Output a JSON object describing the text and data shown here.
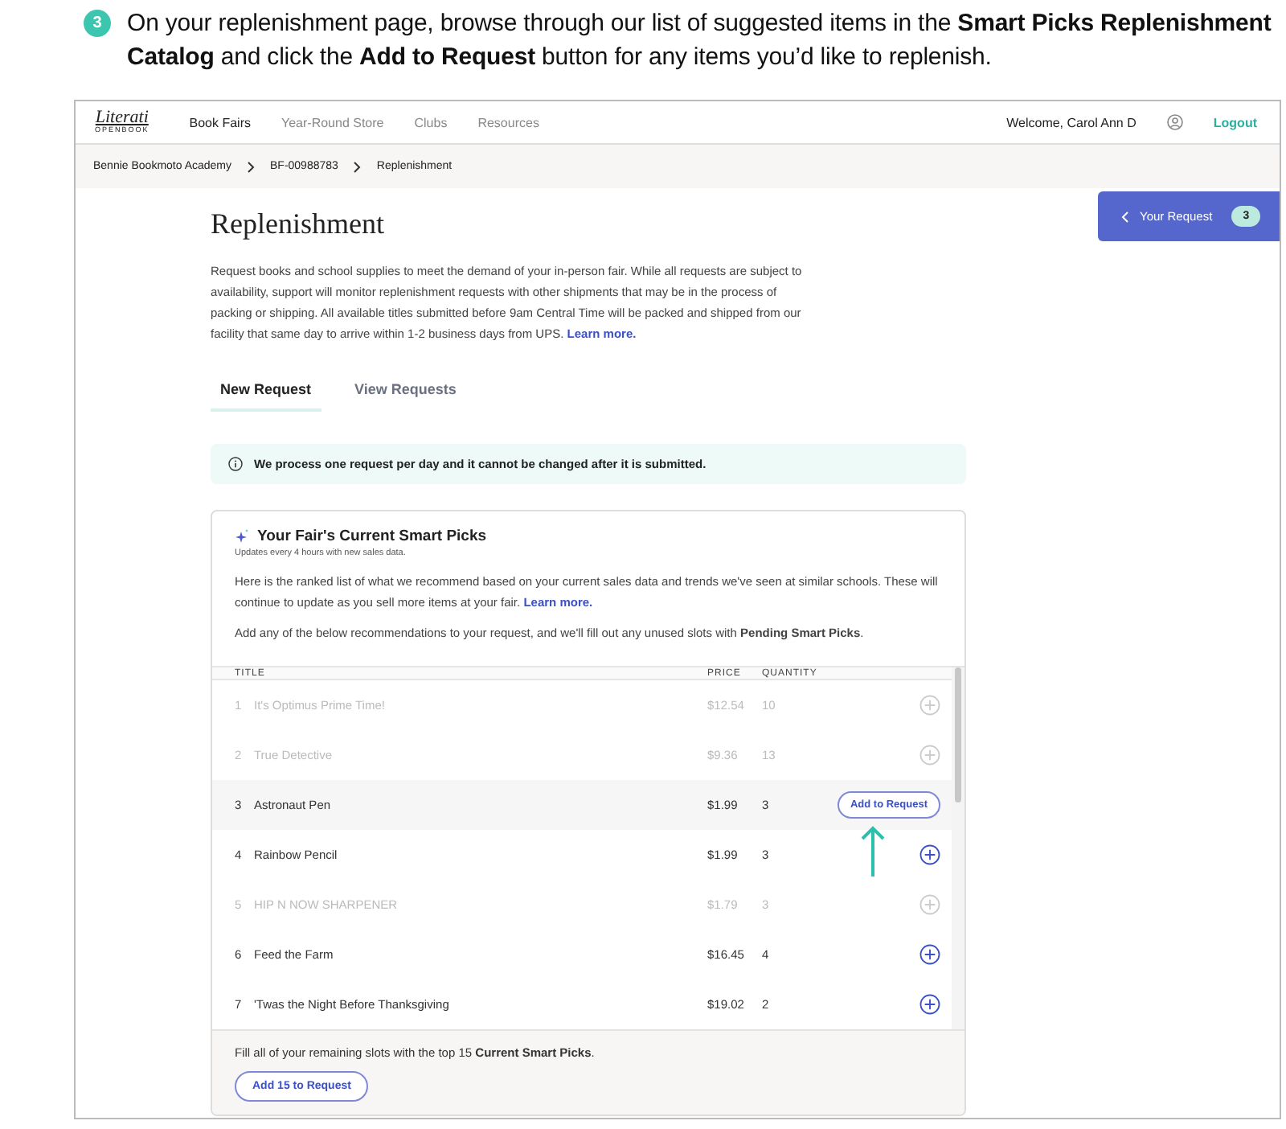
{
  "step": {
    "number": "3",
    "text": "On your replenishment page, browse through our list of suggested items in the **Smart Picks Replenishment Catalog** and click the **Add to Request** button for any items you’d like to replenish."
  },
  "nav": {
    "logo_top": "Literati",
    "logo_bottom": "OPENBOOK",
    "items": [
      {
        "label": "Book Fairs",
        "selected": true
      },
      {
        "label": "Year-Round Store",
        "selected": false
      },
      {
        "label": "Clubs",
        "selected": false
      },
      {
        "label": "Resources",
        "selected": false
      }
    ],
    "welcome": "Welcome, Carol Ann D",
    "logout": "Logout"
  },
  "breadcrumbs": [
    "Bennie Bookmoto Academy",
    "BF-00988783",
    "Replenishment"
  ],
  "your_request": {
    "label": "Your Request",
    "count": "3"
  },
  "page": {
    "title": "Replenishment",
    "intro": "Request books and school supplies to meet the demand of your in-person fair. While all requests are subject to availability, support will monitor replenishment requests with other shipments that may be in the process of packing or shipping. All available titles submitted before 9am Central Time will be packed and shipped from our facility that same day to arrive within 1-2 business days from UPS.",
    "intro_link": "Learn more.",
    "tabs": [
      {
        "label": "New Request",
        "selected": true
      },
      {
        "label": "View Requests",
        "selected": false
      }
    ],
    "notice": "We process one request per day and it cannot be changed after it is submitted."
  },
  "smart_picks": {
    "title": "Your Fair's Current Smart Picks",
    "subtitle": "Updates every 4 hours with new sales data.",
    "description": "Here is the ranked list of what we recommend based on your current sales data and trends we've seen at similar schools. These will continue to update as you sell more items at your fair.",
    "description_link": "Learn more.",
    "instruction": "Add any of the below recommendations to your request, and we'll fill out any unused slots with **Pending Smart Picks**.",
    "columns": [
      "TITLE",
      "PRICE",
      "QUANTITY"
    ],
    "rows": [
      {
        "rank": "1",
        "title": "It's Optimus Prime Time!",
        "price": "$12.54",
        "quantity": "10",
        "disabled": true,
        "kind": "plus"
      },
      {
        "rank": "2",
        "title": "True Detective",
        "price": "$9.36",
        "quantity": "13",
        "disabled": true,
        "kind": "plus"
      },
      {
        "rank": "3",
        "title": "Astronaut Pen",
        "price": "$1.99",
        "quantity": "3",
        "disabled": false,
        "kind": "button",
        "button": "Add to Request"
      },
      {
        "rank": "4",
        "title": "Rainbow Pencil",
        "price": "$1.99",
        "quantity": "3",
        "disabled": false,
        "kind": "plus"
      },
      {
        "rank": "5",
        "title": "HIP N NOW SHARPENER",
        "price": "$1.79",
        "quantity": "3",
        "disabled": true,
        "kind": "plus"
      },
      {
        "rank": "6",
        "title": "Feed the Farm",
        "price": "$16.45",
        "quantity": "4",
        "disabled": false,
        "kind": "plus"
      },
      {
        "rank": "7",
        "title": "'Twas the Night Before Thanksgiving",
        "price": "$19.02",
        "quantity": "2",
        "disabled": false,
        "kind": "plus"
      }
    ],
    "footer_text": "Fill all of your remaining slots with the top 15 **Current Smart Picks**.",
    "footer_button": "Add 15 to Request"
  }
}
